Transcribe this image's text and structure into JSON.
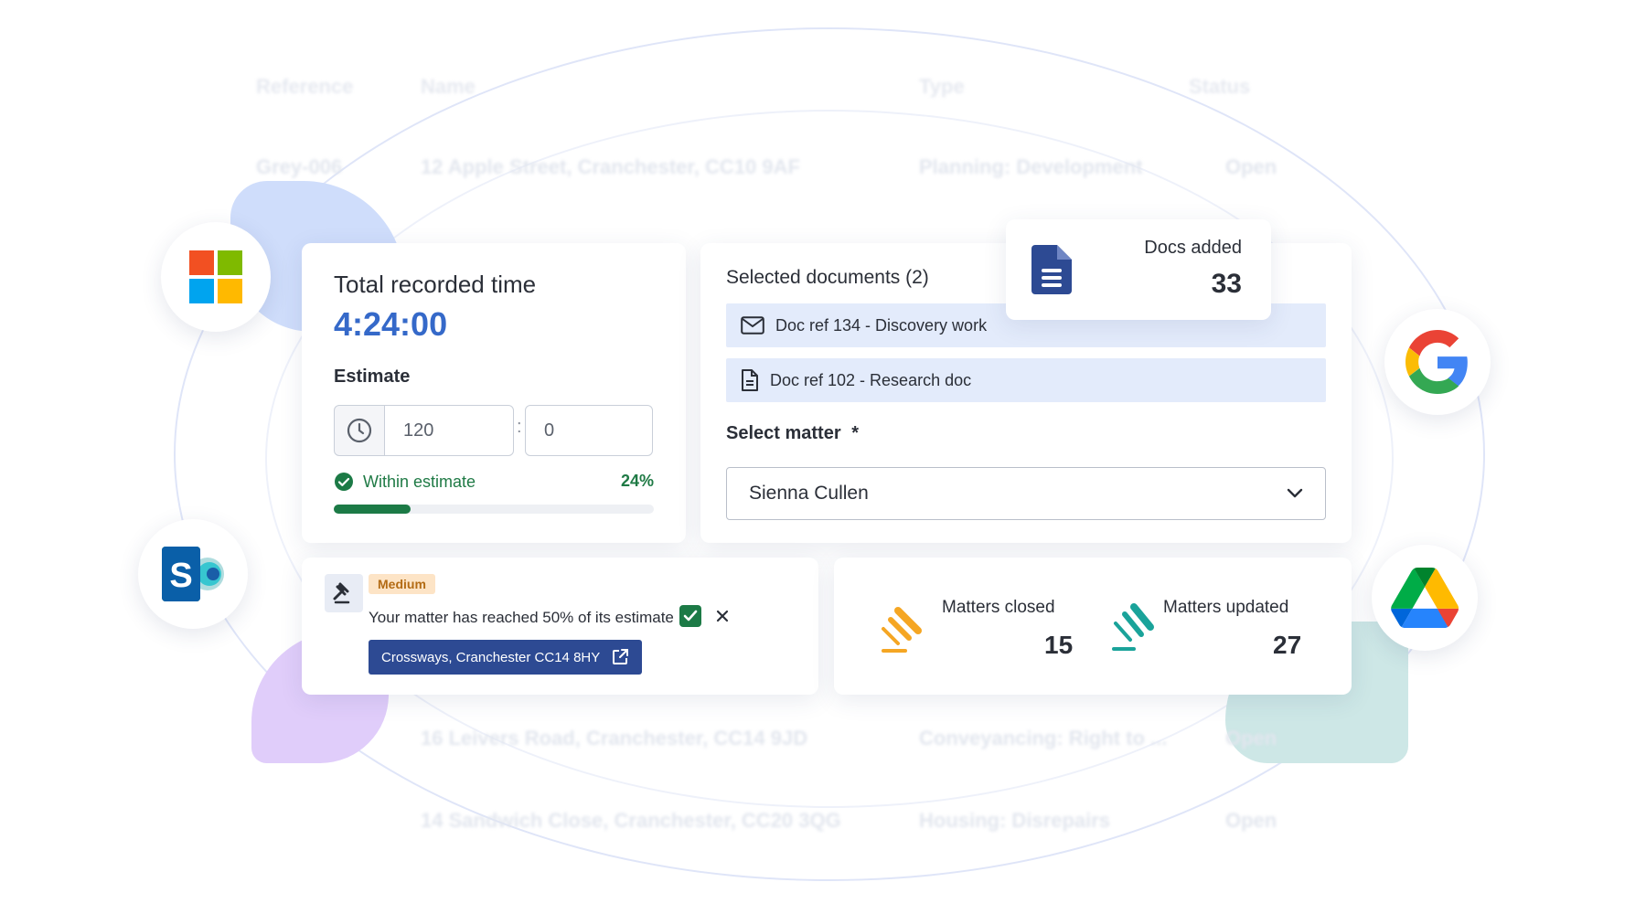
{
  "background_table": {
    "headers": [
      "Reference",
      "Name",
      "Type",
      "Status"
    ],
    "rows": [
      {
        "ref": "Grey-006",
        "name": "12 Apple Street, Cranchester, CC10 9AF",
        "type": "Planning: Development",
        "status": "Open"
      },
      {
        "ref": "",
        "name": "16 Leivers Road, Cranchester, CC14 9JD",
        "type": "Conveyancing: Right to ...",
        "status": "Open"
      },
      {
        "ref": "",
        "name": "14 Sandwich Close, Cranchester, CC20 3QG",
        "type": "Housing: Disrepairs",
        "status": "Open"
      }
    ]
  },
  "time_card": {
    "title": "Total recorded time",
    "value": "4:24:00",
    "estimate_label": "Estimate",
    "hours_value": "120",
    "separator": ":",
    "minutes_value": "0",
    "status_text": "Within estimate",
    "percent_text": "24%",
    "progress_fraction": 0.24
  },
  "documents_card": {
    "title": "Selected documents (2)",
    "documents": [
      {
        "icon": "envelope-icon",
        "label": "Doc ref 134 - Discovery work"
      },
      {
        "icon": "document-icon",
        "label": "Doc ref 102 - Research doc"
      }
    ],
    "matter_label": "Select matter",
    "required_marker": "*",
    "selected_matter": "Sienna Cullen"
  },
  "docs_added": {
    "label": "Docs added",
    "value": "33"
  },
  "alert_card": {
    "priority": "Medium",
    "message": "Your matter has reached 50% of its estimate",
    "link_label": "Crossways, Cranchester CC14 8HY"
  },
  "stats_card": {
    "closed_label": "Matters closed",
    "closed_value": "15",
    "updated_label": "Matters updated",
    "updated_value": "27"
  },
  "integrations": [
    "microsoft-logo",
    "sharepoint-logo",
    "google-logo",
    "google-drive-logo"
  ],
  "colors": {
    "accent_blue": "#3569c9",
    "success_green": "#1c7a46",
    "link_navy": "#2d4a93",
    "badge_bg": "#fde4c6",
    "gavel_orange": "#f5a623",
    "gavel_teal": "#1aa39a",
    "doc_row_bg": "#e3ebfb"
  }
}
